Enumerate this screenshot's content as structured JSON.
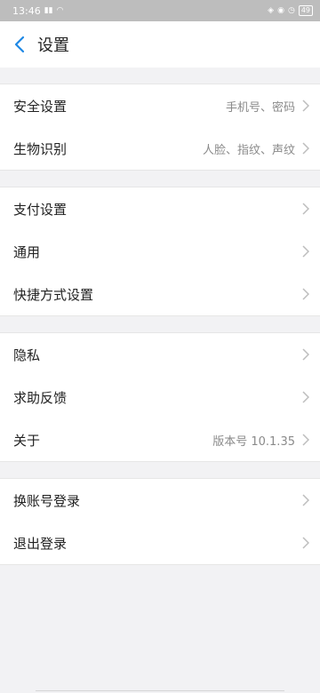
{
  "status_bar": {
    "time": "13:46",
    "battery": "49"
  },
  "header": {
    "title": "设置"
  },
  "groups": [
    {
      "items": [
        {
          "label": "安全设置",
          "value": "手机号、密码"
        },
        {
          "label": "生物识别",
          "value": "人脸、指纹、声纹"
        }
      ]
    },
    {
      "items": [
        {
          "label": "支付设置",
          "value": ""
        },
        {
          "label": "通用",
          "value": ""
        },
        {
          "label": "快捷方式设置",
          "value": ""
        }
      ]
    },
    {
      "items": [
        {
          "label": "隐私",
          "value": ""
        },
        {
          "label": "求助反馈",
          "value": ""
        },
        {
          "label": "关于",
          "value": "版本号 10.1.35"
        }
      ]
    },
    {
      "items": [
        {
          "label": "换账号登录",
          "value": ""
        },
        {
          "label": "退出登录",
          "value": ""
        }
      ]
    }
  ],
  "colors": {
    "accent": "#1e88e5",
    "background": "#f2f2f4"
  }
}
